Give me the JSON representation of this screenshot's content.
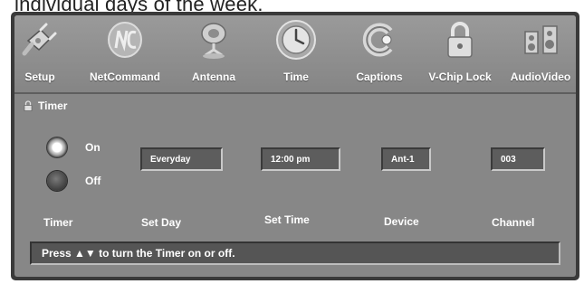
{
  "caption": "individual days of the week.",
  "menu": {
    "items": [
      {
        "label": "Setup",
        "icon": "plug-icon"
      },
      {
        "label": "NetCommand",
        "icon": "netcommand-logo-icon"
      },
      {
        "label": "Antenna",
        "icon": "satellite-dish-icon"
      },
      {
        "label": "Time",
        "icon": "clock-icon",
        "selected": true
      },
      {
        "label": "Captions",
        "icon": "captions-c-icon"
      },
      {
        "label": "V-Chip Lock",
        "icon": "padlock-icon"
      },
      {
        "label": "AudioVideo",
        "icon": "speakers-icon"
      }
    ]
  },
  "timer": {
    "title": "Timer",
    "state": {
      "on_label": "On",
      "off_label": "Off",
      "selected": "On"
    },
    "set_day": "Everyday",
    "set_time": "12:00 pm",
    "device": "Ant-1",
    "channel": "003",
    "labels": {
      "timer": "Timer",
      "set_day": "Set Day",
      "set_time": "Set Time",
      "device": "Device",
      "channel": "Channel"
    }
  },
  "status": {
    "hint": "Press ▲▼ to turn the Timer on or off."
  },
  "colors": {
    "panel": "#878787",
    "frame": "#3a3a3a",
    "field": "#5d5d5d",
    "text": "#ffffff"
  }
}
